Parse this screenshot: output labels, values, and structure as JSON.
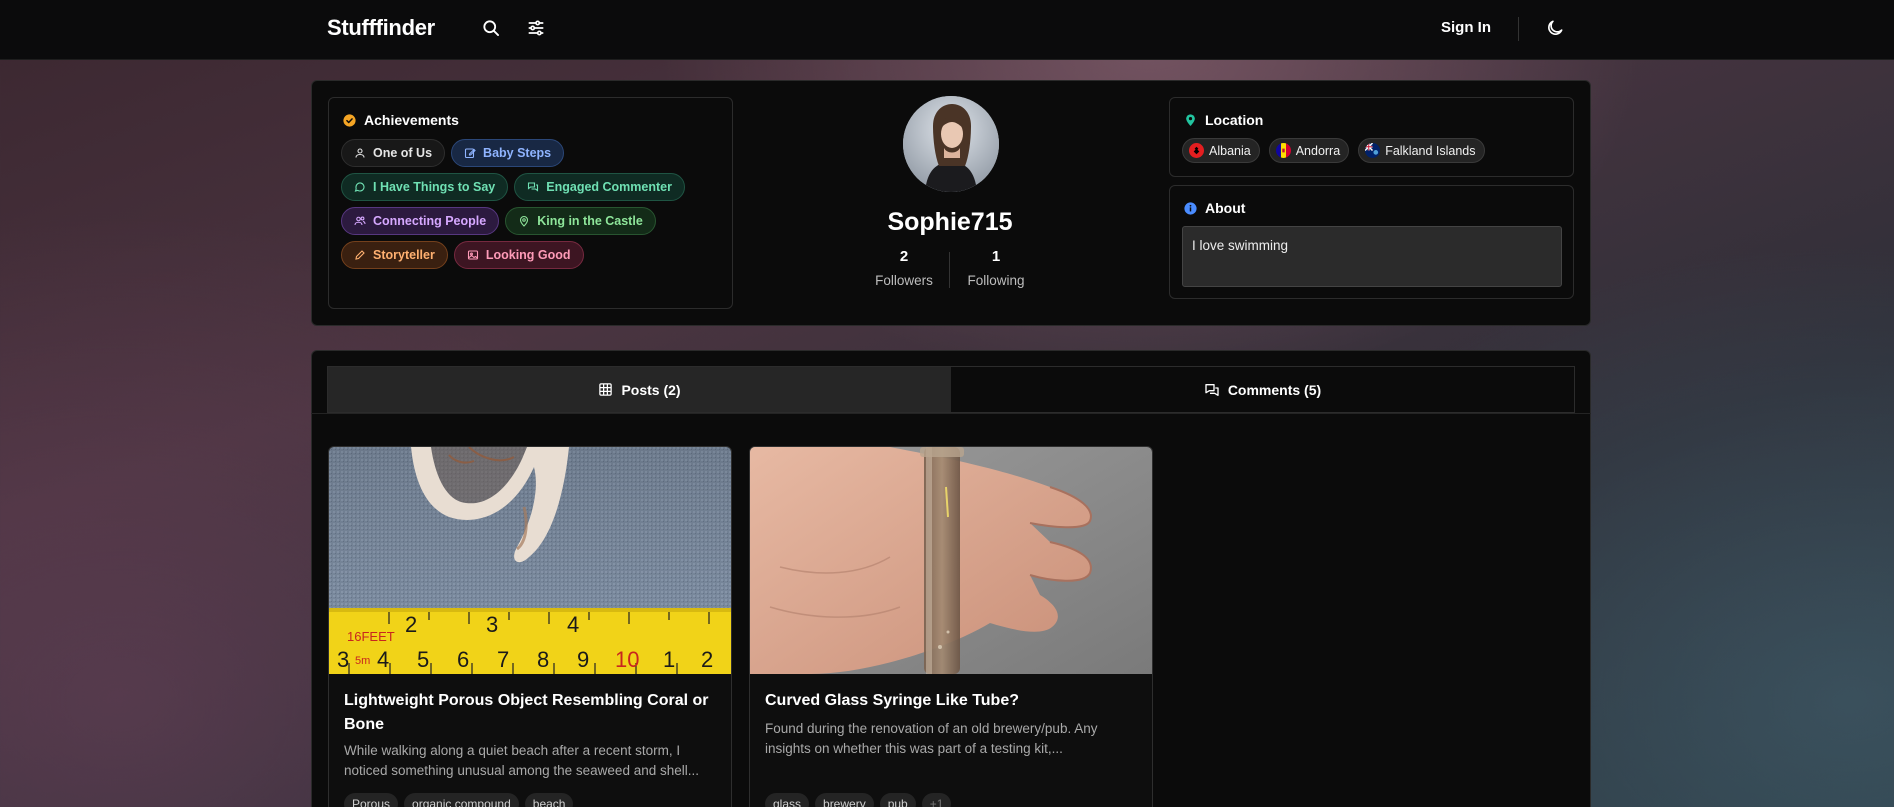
{
  "nav": {
    "brand": "Stufffinder",
    "search_icon": "search-icon",
    "filter_icon": "sliders-icon",
    "sign_in": "Sign In",
    "theme_icon": "moon-icon"
  },
  "profile": {
    "username": "Sophie715",
    "followers_count": "2",
    "followers_label": "Followers",
    "following_count": "1",
    "following_label": "Following"
  },
  "achievements": {
    "title": "Achievements",
    "items": [
      {
        "label": "One of Us",
        "icon": "user-icon",
        "color": "gray"
      },
      {
        "label": "Baby Steps",
        "icon": "edit-icon",
        "color": "blue"
      },
      {
        "label": "I Have Things to Say",
        "icon": "message-icon",
        "color": "teal"
      },
      {
        "label": "Engaged Commenter",
        "icon": "messages-icon",
        "color": "teal"
      },
      {
        "label": "Connecting People",
        "icon": "users-icon",
        "color": "purple"
      },
      {
        "label": "King in the Castle",
        "icon": "map-pin-icon",
        "color": "green"
      },
      {
        "label": "Storyteller",
        "icon": "pencil-icon",
        "color": "orange"
      },
      {
        "label": "Looking Good",
        "icon": "image-icon",
        "color": "pink"
      }
    ]
  },
  "location": {
    "title": "Location",
    "countries": [
      "Albania",
      "Andorra",
      "Falkland Islands"
    ]
  },
  "about": {
    "title": "About",
    "text": "I love swimming"
  },
  "tabs": [
    {
      "label": "Posts (2)",
      "icon": "grid-icon",
      "active": true
    },
    {
      "label": "Comments (5)",
      "icon": "comments-icon",
      "active": false
    }
  ],
  "posts": [
    {
      "title": "Lightweight Porous Object Resembling Coral or Bone",
      "description": "While walking along a quiet beach after a recent storm, I noticed something unusual among the seaweed and shell...",
      "tags": [
        "Porous",
        "organic compound",
        "beach"
      ],
      "tape_text": "16FEET",
      "tape_sub": "5m",
      "tape_numbers_top": [
        "2",
        "3",
        "4"
      ],
      "tape_numbers_bottom": [
        "3",
        "4",
        "5",
        "6",
        "7",
        "8",
        "9",
        "10",
        "1",
        "2"
      ]
    },
    {
      "title": "Curved Glass Syringe Like Tube?",
      "description": "Found during the renovation of an old brewery/pub. Any insights on whether this was part of a testing kit,...",
      "tags": [
        "glass",
        "brewery",
        "pub",
        "+1"
      ]
    }
  ],
  "colors": {
    "achievements_icon": "#f5a524",
    "location_icon": "#22c5a0",
    "about_icon": "#4a8cff"
  }
}
